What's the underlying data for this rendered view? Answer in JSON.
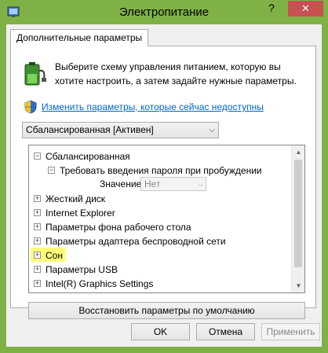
{
  "window": {
    "title": "Электропитание",
    "help_label": "?",
    "close_label": "✕"
  },
  "tab": {
    "label": "Дополнительные параметры"
  },
  "description": "Выберите схему управления питанием, которую вы хотите настроить, а затем задайте нужные параметры.",
  "admin_link": "Изменить параметры, которые сейчас недоступны",
  "scheme_select": {
    "value": "Сбалансированная [Активен]"
  },
  "tree": {
    "items": [
      {
        "label": "Сбалансированная",
        "expander": "−"
      },
      {
        "label": "Требовать введения пароля при пробуждении",
        "expander": "−"
      },
      {
        "label": "Жесткий диск",
        "expander": "+"
      },
      {
        "label": "Internet Explorer",
        "expander": "+"
      },
      {
        "label": "Параметры фона рабочего стола",
        "expander": "+"
      },
      {
        "label": "Параметры адаптера беспроводной сети",
        "expander": "+"
      },
      {
        "label": "Сон",
        "expander": "+",
        "highlighted": true
      },
      {
        "label": "Параметры USB",
        "expander": "+"
      },
      {
        "label": "Intel(R) Graphics Settings",
        "expander": "+"
      }
    ],
    "value_label": "Значение:",
    "value_select": "Нет"
  },
  "restore_button": "Восстановить параметры по умолчанию",
  "buttons": {
    "ok": "OK",
    "cancel": "Отмена",
    "apply": "Применить"
  },
  "colors": {
    "titlebar": "#7fb146",
    "close_button": "#c75050",
    "link": "#0066cc",
    "highlight": "#ffff7a"
  }
}
